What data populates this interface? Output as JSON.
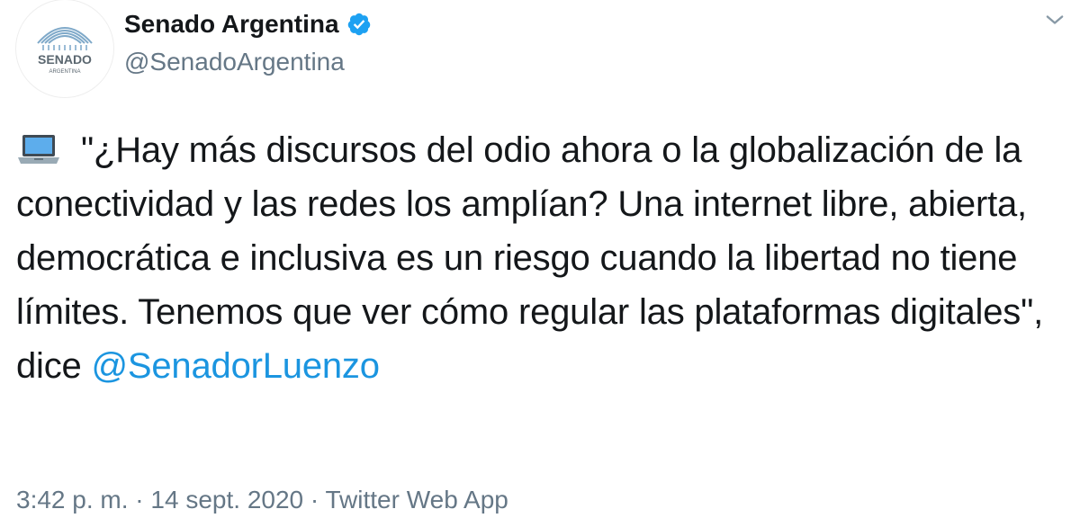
{
  "account": {
    "display_name": "Senado Argentina",
    "handle": "@SenadoArgentina",
    "verified": true,
    "avatar_wordmark_top": "SENADO",
    "avatar_wordmark_bottom": "ARGENTINA"
  },
  "tweet": {
    "text_main": "\"¿Hay más discursos del odio ahora o la globalización de la conectividad y las redes los amplían? Una internet libre, abierta, democrática e inclusiva es un riesgo cuando la libertad no tiene límites. Tenemos que ver cómo regular las plataformas digitales\", dice ",
    "mention": "@SenadorLuenzo",
    "emoji": "laptop-emoji"
  },
  "meta": {
    "time": "3:42 p. m.",
    "separator": "·",
    "date": "14 sept. 2020",
    "source": "Twitter Web App"
  },
  "colors": {
    "text": "#14171a",
    "secondary": "#657786",
    "link": "#1b95e0",
    "verified": "#1da1f2"
  },
  "icons": {
    "verified": "verified-badge-icon",
    "more": "chevron-down-icon"
  }
}
